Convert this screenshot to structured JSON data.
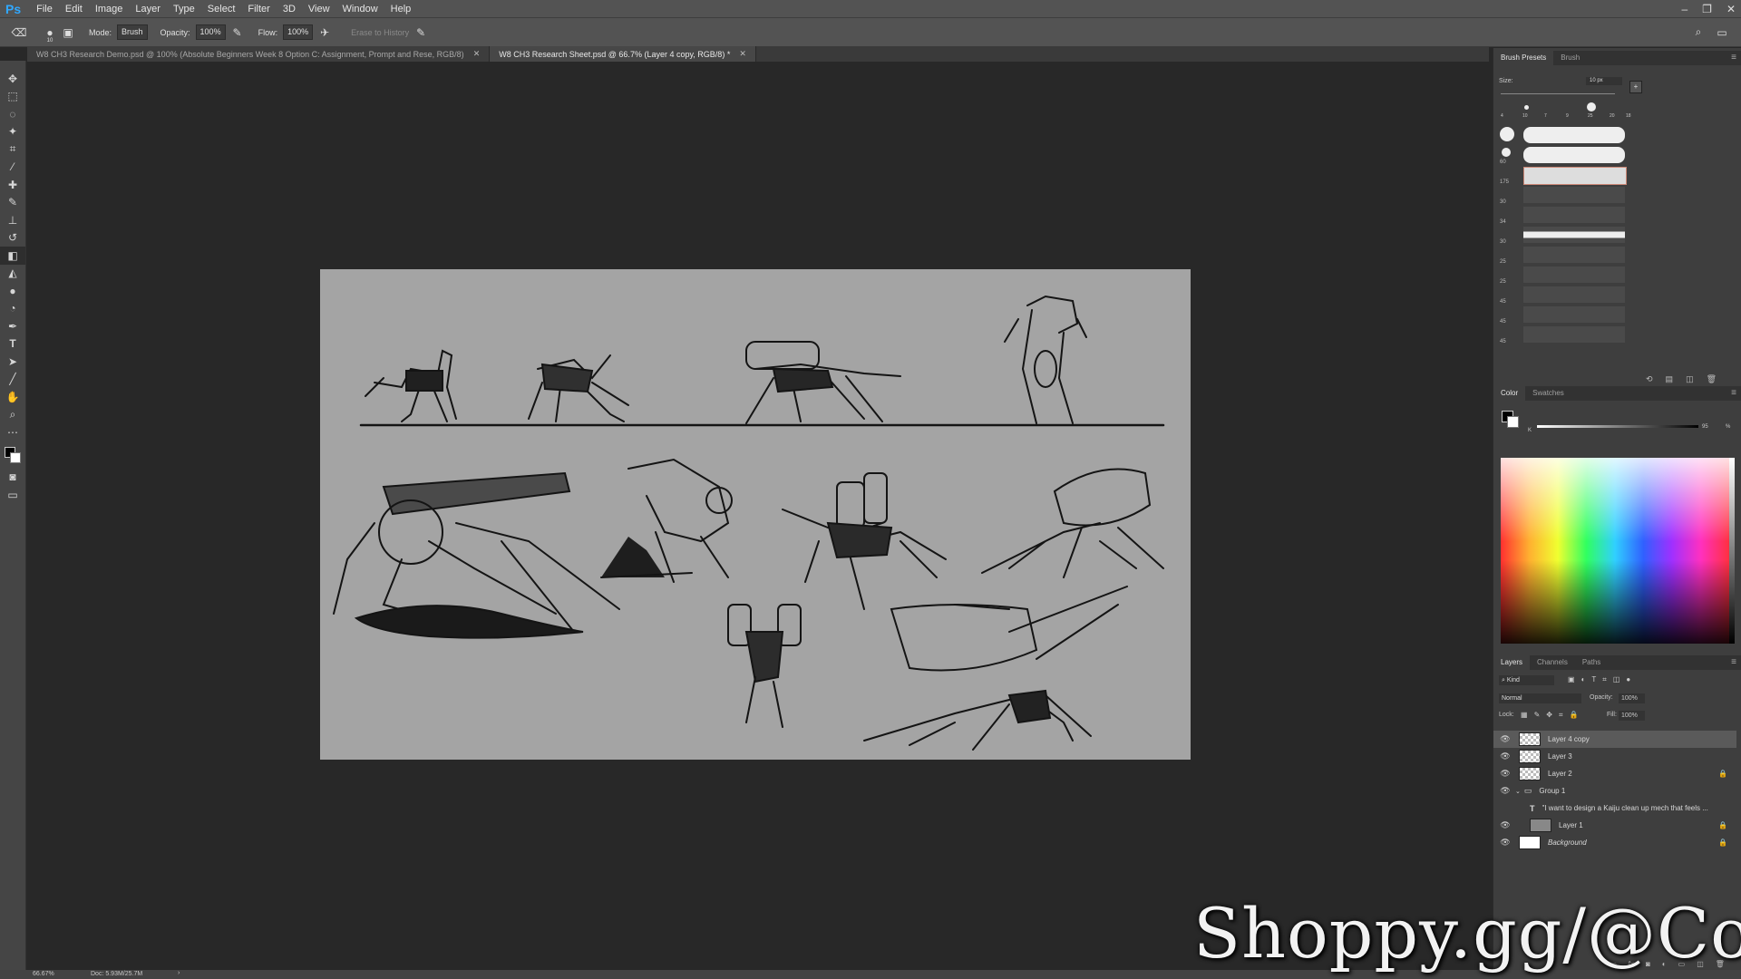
{
  "app": {
    "logo": "Ps"
  },
  "menu": [
    "File",
    "Edit",
    "Image",
    "Layer",
    "Type",
    "Select",
    "Filter",
    "3D",
    "View",
    "Window",
    "Help"
  ],
  "window_controls": [
    "–",
    "❐",
    "✕"
  ],
  "options": {
    "brush_size": "10",
    "mode_label": "Mode:",
    "mode_value": "Brush",
    "opacity_label": "Opacity:",
    "opacity_value": "100%",
    "flow_label": "Flow:",
    "flow_value": "100%",
    "erase_to_history": "Erase to History"
  },
  "tabs": [
    {
      "label": "W8 CH3 Research Demo.psd @ 100% (Absolute Beginners Week 8 Option C: Assignment, Prompt and Rese, RGB/8)",
      "close": "✕"
    },
    {
      "label": "W8 CH3 Research Sheet.psd @ 66.7% (Layer 4 copy, RGB/8) *",
      "close": "✕"
    }
  ],
  "tools": [
    "move-icon",
    "marquee-icon",
    "lasso-icon",
    "magic-wand-icon",
    "crop-icon",
    "eyedropper-icon",
    "healing-icon",
    "brush-icon",
    "stamp-icon",
    "history-brush-icon",
    "eraser-icon",
    "bucket-icon",
    "blur-icon",
    "dodge-icon",
    "pen-icon",
    "type-icon",
    "path-select-icon",
    "line-icon",
    "hand-icon",
    "zoom-icon",
    "more-icon"
  ],
  "brush_panel": {
    "tabs": [
      "Brush Presets",
      "Brush"
    ],
    "size_label": "Size:",
    "size_value": "10 px",
    "tips": [
      "4",
      "10",
      "7",
      "9",
      "25",
      "20",
      "18"
    ],
    "presets": [
      "",
      "60",
      "175",
      "30",
      "34",
      "30",
      "25",
      "25",
      "45",
      "45",
      "45"
    ]
  },
  "color_panel": {
    "tabs": [
      "Color",
      "Swatches"
    ],
    "k_label": "K",
    "k_value": "95",
    "percent": "%"
  },
  "layers_panel": {
    "tabs": [
      "Layers",
      "Channels",
      "Paths"
    ],
    "filter_label": "Kind",
    "blend_mode": "Normal",
    "opacity_label": "Opacity:",
    "opacity_value": "100%",
    "lock_label": "Lock:",
    "fill_label": "Fill:",
    "fill_value": "100%",
    "layers": [
      {
        "name": "Layer 4 copy",
        "selected": true
      },
      {
        "name": "Layer 3"
      },
      {
        "name": "Layer 2"
      },
      {
        "name": "Group 1"
      },
      {
        "name": "\"I want to design a Kaiju clean up mech that feels ..."
      },
      {
        "name": "Layer 1"
      },
      {
        "name": "Background"
      }
    ]
  },
  "status": {
    "zoom": "66.67%",
    "doc": "Doc: 5.93M/25.7M"
  },
  "watermark": "Shoppy.gg/@Coft",
  "colors": {
    "accent": "#31a8ff",
    "canvas": "#a4a4a4",
    "panel": "#3e3e3e",
    "chrome": "#535353"
  }
}
